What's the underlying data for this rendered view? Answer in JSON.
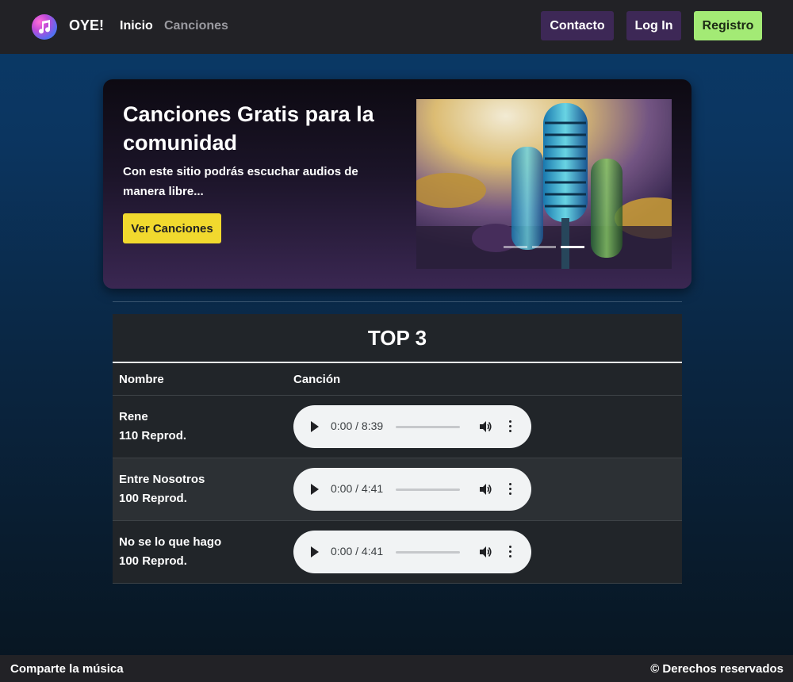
{
  "navbar": {
    "brand": "OYE!",
    "links": [
      "Inicio",
      "Canciones"
    ],
    "buttons": {
      "contacto": "Contacto",
      "login": "Log In",
      "registro": "Registro"
    }
  },
  "hero": {
    "title": "Canciones Gratis para la comunidad",
    "subtitle": "Con este sitio podrás escuchar audios de manera libre...",
    "cta": "Ver Canciones",
    "carousel": {
      "slides": 3,
      "active": 3
    }
  },
  "top": {
    "title": "TOP 3",
    "headers": {
      "name": "Nombre",
      "song": "Canción"
    },
    "rows": [
      {
        "name": "Rene",
        "plays": "110 Reprod.",
        "time": "0:00 / 8:39"
      },
      {
        "name": "Entre Nosotros",
        "plays": "100 Reprod.",
        "time": "0:00 / 4:41"
      },
      {
        "name": "No se lo que hago",
        "plays": "100 Reprod.",
        "time": "0:00 / 4:41"
      }
    ]
  },
  "footer": {
    "left": "Comparte la música",
    "right": "© Derechos reservados"
  },
  "colors": {
    "accent_purple": "#3d2856",
    "registro_green": "#a3ea75",
    "cta_yellow": "#f1d92e"
  }
}
